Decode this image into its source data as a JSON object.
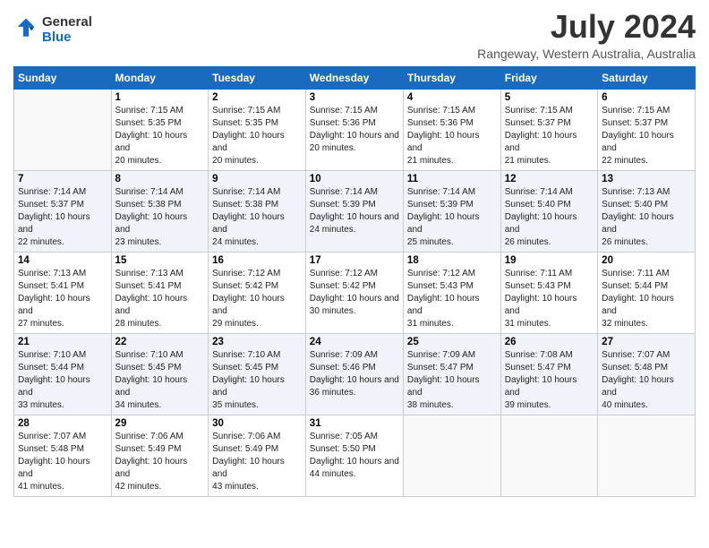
{
  "header": {
    "logo_general": "General",
    "logo_blue": "Blue",
    "title": "July 2024",
    "location": "Rangeway, Western Australia, Australia"
  },
  "days_of_week": [
    "Sunday",
    "Monday",
    "Tuesday",
    "Wednesday",
    "Thursday",
    "Friday",
    "Saturday"
  ],
  "weeks": [
    [
      {
        "day": "",
        "sunrise": "",
        "sunset": "",
        "daylight": ""
      },
      {
        "day": "1",
        "sunrise": "Sunrise: 7:15 AM",
        "sunset": "Sunset: 5:35 PM",
        "daylight": "Daylight: 10 hours and 20 minutes."
      },
      {
        "day": "2",
        "sunrise": "Sunrise: 7:15 AM",
        "sunset": "Sunset: 5:35 PM",
        "daylight": "Daylight: 10 hours and 20 minutes."
      },
      {
        "day": "3",
        "sunrise": "Sunrise: 7:15 AM",
        "sunset": "Sunset: 5:36 PM",
        "daylight": "Daylight: 10 hours and 20 minutes."
      },
      {
        "day": "4",
        "sunrise": "Sunrise: 7:15 AM",
        "sunset": "Sunset: 5:36 PM",
        "daylight": "Daylight: 10 hours and 21 minutes."
      },
      {
        "day": "5",
        "sunrise": "Sunrise: 7:15 AM",
        "sunset": "Sunset: 5:37 PM",
        "daylight": "Daylight: 10 hours and 21 minutes."
      },
      {
        "day": "6",
        "sunrise": "Sunrise: 7:15 AM",
        "sunset": "Sunset: 5:37 PM",
        "daylight": "Daylight: 10 hours and 22 minutes."
      }
    ],
    [
      {
        "day": "7",
        "sunrise": "Sunrise: 7:14 AM",
        "sunset": "Sunset: 5:37 PM",
        "daylight": "Daylight: 10 hours and 22 minutes."
      },
      {
        "day": "8",
        "sunrise": "Sunrise: 7:14 AM",
        "sunset": "Sunset: 5:38 PM",
        "daylight": "Daylight: 10 hours and 23 minutes."
      },
      {
        "day": "9",
        "sunrise": "Sunrise: 7:14 AM",
        "sunset": "Sunset: 5:38 PM",
        "daylight": "Daylight: 10 hours and 24 minutes."
      },
      {
        "day": "10",
        "sunrise": "Sunrise: 7:14 AM",
        "sunset": "Sunset: 5:39 PM",
        "daylight": "Daylight: 10 hours and 24 minutes."
      },
      {
        "day": "11",
        "sunrise": "Sunrise: 7:14 AM",
        "sunset": "Sunset: 5:39 PM",
        "daylight": "Daylight: 10 hours and 25 minutes."
      },
      {
        "day": "12",
        "sunrise": "Sunrise: 7:14 AM",
        "sunset": "Sunset: 5:40 PM",
        "daylight": "Daylight: 10 hours and 26 minutes."
      },
      {
        "day": "13",
        "sunrise": "Sunrise: 7:13 AM",
        "sunset": "Sunset: 5:40 PM",
        "daylight": "Daylight: 10 hours and 26 minutes."
      }
    ],
    [
      {
        "day": "14",
        "sunrise": "Sunrise: 7:13 AM",
        "sunset": "Sunset: 5:41 PM",
        "daylight": "Daylight: 10 hours and 27 minutes."
      },
      {
        "day": "15",
        "sunrise": "Sunrise: 7:13 AM",
        "sunset": "Sunset: 5:41 PM",
        "daylight": "Daylight: 10 hours and 28 minutes."
      },
      {
        "day": "16",
        "sunrise": "Sunrise: 7:12 AM",
        "sunset": "Sunset: 5:42 PM",
        "daylight": "Daylight: 10 hours and 29 minutes."
      },
      {
        "day": "17",
        "sunrise": "Sunrise: 7:12 AM",
        "sunset": "Sunset: 5:42 PM",
        "daylight": "Daylight: 10 hours and 30 minutes."
      },
      {
        "day": "18",
        "sunrise": "Sunrise: 7:12 AM",
        "sunset": "Sunset: 5:43 PM",
        "daylight": "Daylight: 10 hours and 31 minutes."
      },
      {
        "day": "19",
        "sunrise": "Sunrise: 7:11 AM",
        "sunset": "Sunset: 5:43 PM",
        "daylight": "Daylight: 10 hours and 31 minutes."
      },
      {
        "day": "20",
        "sunrise": "Sunrise: 7:11 AM",
        "sunset": "Sunset: 5:44 PM",
        "daylight": "Daylight: 10 hours and 32 minutes."
      }
    ],
    [
      {
        "day": "21",
        "sunrise": "Sunrise: 7:10 AM",
        "sunset": "Sunset: 5:44 PM",
        "daylight": "Daylight: 10 hours and 33 minutes."
      },
      {
        "day": "22",
        "sunrise": "Sunrise: 7:10 AM",
        "sunset": "Sunset: 5:45 PM",
        "daylight": "Daylight: 10 hours and 34 minutes."
      },
      {
        "day": "23",
        "sunrise": "Sunrise: 7:10 AM",
        "sunset": "Sunset: 5:45 PM",
        "daylight": "Daylight: 10 hours and 35 minutes."
      },
      {
        "day": "24",
        "sunrise": "Sunrise: 7:09 AM",
        "sunset": "Sunset: 5:46 PM",
        "daylight": "Daylight: 10 hours and 36 minutes."
      },
      {
        "day": "25",
        "sunrise": "Sunrise: 7:09 AM",
        "sunset": "Sunset: 5:47 PM",
        "daylight": "Daylight: 10 hours and 38 minutes."
      },
      {
        "day": "26",
        "sunrise": "Sunrise: 7:08 AM",
        "sunset": "Sunset: 5:47 PM",
        "daylight": "Daylight: 10 hours and 39 minutes."
      },
      {
        "day": "27",
        "sunrise": "Sunrise: 7:07 AM",
        "sunset": "Sunset: 5:48 PM",
        "daylight": "Daylight: 10 hours and 40 minutes."
      }
    ],
    [
      {
        "day": "28",
        "sunrise": "Sunrise: 7:07 AM",
        "sunset": "Sunset: 5:48 PM",
        "daylight": "Daylight: 10 hours and 41 minutes."
      },
      {
        "day": "29",
        "sunrise": "Sunrise: 7:06 AM",
        "sunset": "Sunset: 5:49 PM",
        "daylight": "Daylight: 10 hours and 42 minutes."
      },
      {
        "day": "30",
        "sunrise": "Sunrise: 7:06 AM",
        "sunset": "Sunset: 5:49 PM",
        "daylight": "Daylight: 10 hours and 43 minutes."
      },
      {
        "day": "31",
        "sunrise": "Sunrise: 7:05 AM",
        "sunset": "Sunset: 5:50 PM",
        "daylight": "Daylight: 10 hours and 44 minutes."
      },
      {
        "day": "",
        "sunrise": "",
        "sunset": "",
        "daylight": ""
      },
      {
        "day": "",
        "sunrise": "",
        "sunset": "",
        "daylight": ""
      },
      {
        "day": "",
        "sunrise": "",
        "sunset": "",
        "daylight": ""
      }
    ]
  ]
}
